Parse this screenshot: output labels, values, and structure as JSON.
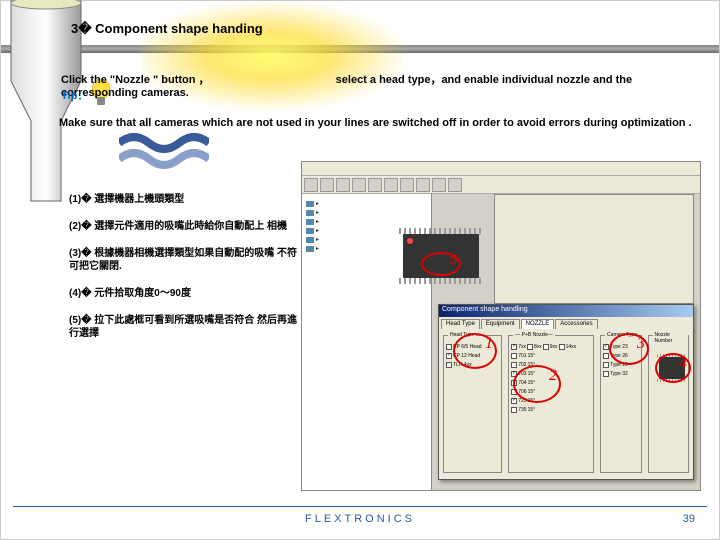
{
  "title": "3� Component shape handing",
  "line1_a": "Click the \"Nozzle \" button ，",
  "line1_b": "select a head type，and enable individual nozzle and the corresponding cameras.",
  "tip": "Tip：",
  "line2": "Make sure that all cameras which are not used in your lines are switched off in order to avoid errors during optimization .",
  "items": [
    "(1)� 選擇機器上機頭類型",
    "(2)� 選擇元件適用的吸嘴此時給你自動配上\n相機",
    "(3)� 根據機器相機選擇類型如果自動配的吸嘴\n不符可把它關閉.",
    "(4)� 元件拾取角度0～90度",
    "(5)� 拉下此處框可看到所選吸嘴是否符合\n然后再進行選擇"
  ],
  "dialog": {
    "title": "Component shape handling",
    "tabs": [
      "Head Type",
      "Equipment",
      "NOZZLE",
      "Accessories"
    ],
    "headType": {
      "label": "Head Type",
      "rows": [
        "CP 6/5 Head",
        "CP 12 Head",
        "TLH 4xx"
      ]
    },
    "nozzle": {
      "label": "— P+B Nozzle—",
      "series": [
        "7xx",
        "8xx",
        "9xx",
        "14xx"
      ],
      "range": "15°",
      "rows": [
        "701",
        "702",
        "703",
        "704",
        "706",
        "725",
        "735"
      ]
    },
    "camera": {
      "label": "Camera Type"
    },
    "nozNum": {
      "label": "Nozzle Number"
    }
  },
  "annotations": [
    "1",
    "2",
    "3",
    "4",
    "5"
  ],
  "footer": "FLEXTRONICS",
  "pageNum": "39"
}
